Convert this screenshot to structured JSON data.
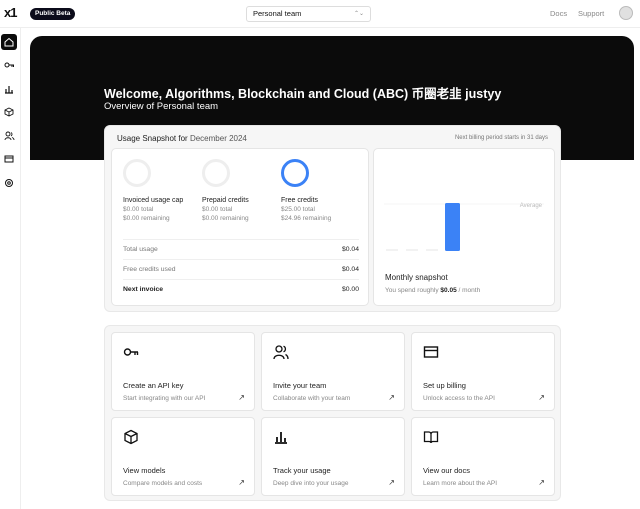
{
  "header": {
    "logo": "x1",
    "badge": "Public Beta",
    "team_select": "Personal team",
    "links": [
      "Docs",
      "Support"
    ]
  },
  "sidebar": {
    "items": [
      "home-icon",
      "key-icon",
      "bar-chart-icon",
      "cube-icon",
      "users-icon",
      "credit-card-icon",
      "settings-icon"
    ]
  },
  "hero": {
    "title": "Welcome, Algorithms, Blockchain and Cloud (ABC) 币圈老韭 justyy",
    "subtitle": "Overview of Personal team"
  },
  "snapshot": {
    "title_prefix": "Usage Snapshot for",
    "month": "December 2024",
    "next_billing": "Next billing period starts in 31 days",
    "credits": [
      {
        "name": "Invoiced usage cap",
        "total": "$0.00 total",
        "remaining": "$0.00 remaining",
        "used_fraction": 0
      },
      {
        "name": "Prepaid credits",
        "total": "$0.00 total",
        "remaining": "$0.00 remaining",
        "used_fraction": 0
      },
      {
        "name": "Free credits",
        "total": "$25.00 total",
        "remaining": "$24.96 remaining",
        "used_fraction": 0.0016
      }
    ],
    "rows": [
      {
        "label": "Total usage",
        "value": "$0.04"
      },
      {
        "label": "Free credits used",
        "value": "$0.04"
      },
      {
        "label": "Next invoice",
        "value": "$0.00"
      }
    ],
    "monthly": {
      "average_label": "Average",
      "title": "Monthly snapshot",
      "sub_prefix": "You spend roughly",
      "amount": "$0.05",
      "sub_suffix": "/ month",
      "bar_color": "#3b82f6"
    }
  },
  "actions": [
    {
      "icon": "key-icon",
      "title": "Create an API key",
      "desc": "Start integrating with our API"
    },
    {
      "icon": "users-icon",
      "title": "Invite your team",
      "desc": "Collaborate with your team"
    },
    {
      "icon": "credit-card-icon",
      "title": "Set up billing",
      "desc": "Unlock access to the API"
    },
    {
      "icon": "cube-icon",
      "title": "View models",
      "desc": "Compare models and costs"
    },
    {
      "icon": "bar-chart-icon",
      "title": "Track your usage",
      "desc": "Deep dive into your usage"
    },
    {
      "icon": "book-icon",
      "title": "View our docs",
      "desc": "Learn more about the API"
    }
  ],
  "colors": {
    "accent": "#3b82f6",
    "hero_bg": "#0b0b0b"
  }
}
